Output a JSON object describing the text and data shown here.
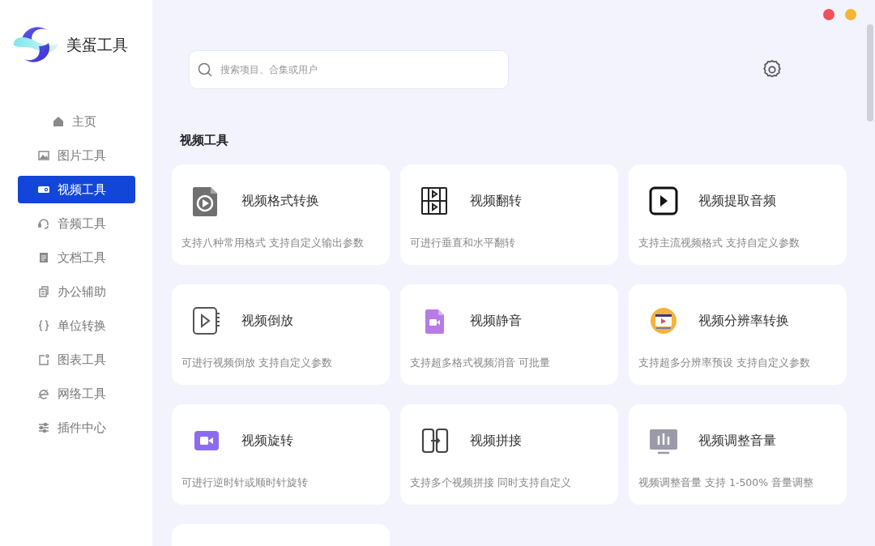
{
  "app": {
    "name": "美蛋工具"
  },
  "sidebar": {
    "items": [
      {
        "label": "主页",
        "selected": false
      },
      {
        "label": "图片工具",
        "selected": false
      },
      {
        "label": "视频工具",
        "selected": true
      },
      {
        "label": "音频工具",
        "selected": false
      },
      {
        "label": "文档工具",
        "selected": false
      },
      {
        "label": "办公辅助",
        "selected": false
      },
      {
        "label": "单位转换",
        "selected": false
      },
      {
        "label": "图表工具",
        "selected": false
      },
      {
        "label": "网络工具",
        "selected": false
      },
      {
        "label": "插件中心",
        "selected": false
      }
    ]
  },
  "search": {
    "placeholder": "搜索项目、合集或用户"
  },
  "section": {
    "title": "视频工具"
  },
  "tools": [
    {
      "title": "视频格式转换",
      "description": "支持八种常用格式 支持自定义输出参数"
    },
    {
      "title": "视频翻转",
      "description": "可进行垂直和水平翻转"
    },
    {
      "title": "视频提取音频",
      "description": "支持主流视频格式 支持自定义参数"
    },
    {
      "title": "视频倒放",
      "description": "可进行视频倒放 支持自定义参数"
    },
    {
      "title": "视频静音",
      "description": "支持超多格式视频消音 可批量"
    },
    {
      "title": "视频分辨率转换",
      "description": "支持超多分辨率预设 支持自定义参数"
    },
    {
      "title": "视频旋转",
      "description": "可进行逆时针或顺时针旋转"
    },
    {
      "title": "视频拼接",
      "description": "支持多个视频拼接 同时支持自定义"
    },
    {
      "title": "视频调整音量",
      "description": "视频调整音量 支持 1-500% 音量调整"
    }
  ]
}
